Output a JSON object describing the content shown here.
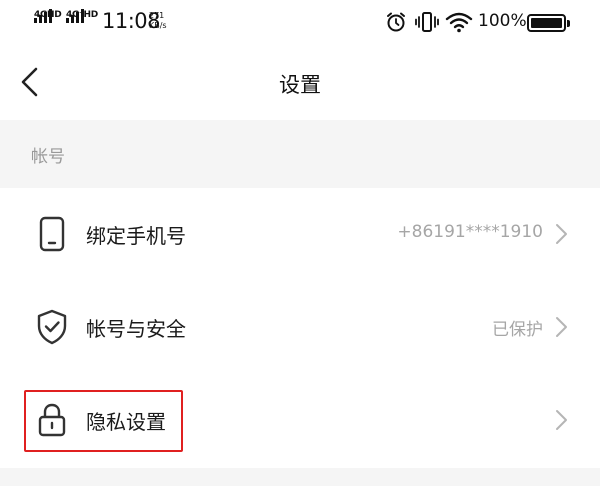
{
  "status_bar": {
    "network1": "4GHD",
    "network2": "4G⁺HD",
    "time": "11:08",
    "speed_value": "271",
    "speed_unit": "KB/s",
    "battery_percent": "100%",
    "battery_level": 1.0
  },
  "header": {
    "title": "设置"
  },
  "section": {
    "label": "帐号"
  },
  "rows": [
    {
      "label": "绑定手机号",
      "value": "+86191****1910",
      "icon": "phone-icon"
    },
    {
      "label": "帐号与安全",
      "value": "已保护",
      "icon": "shield-check-icon"
    },
    {
      "label": "隐私设置",
      "value": "",
      "icon": "lock-icon"
    }
  ],
  "colors": {
    "highlight": "#e02020",
    "section_bg": "#f5f5f5",
    "secondary_text": "#a6a6a6"
  }
}
